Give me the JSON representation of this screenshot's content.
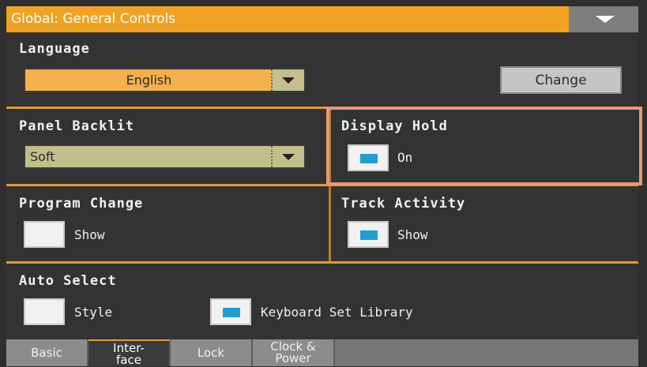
{
  "window": {
    "title": "Global: General Controls"
  },
  "sections": {
    "language": {
      "label": "Language",
      "selected": "English",
      "change_label": "Change"
    },
    "panel_backlit": {
      "label": "Panel Backlit",
      "selected": "Soft"
    },
    "display_hold": {
      "label": "Display Hold",
      "checkbox_label": "On",
      "checked": true
    },
    "program_change": {
      "label": "Program Change",
      "checkbox_label": "Show",
      "checked": false
    },
    "track_activity": {
      "label": "Track Activity",
      "checkbox_label": "Show",
      "checked": true
    },
    "auto_select": {
      "label": "Auto Select",
      "style_label": "Style",
      "style_checked": false,
      "kbd_label": "Keyboard Set Library",
      "kbd_checked": true
    }
  },
  "tabs": [
    {
      "line1": "Basic",
      "line2": ""
    },
    {
      "line1": "Inter-",
      "line2": "face",
      "active": true
    },
    {
      "line1": "Lock",
      "line2": ""
    },
    {
      "line1": "Clock &",
      "line2": "Power"
    }
  ],
  "colors": {
    "accent": "#f0a222",
    "check_fill": "#1d9fd4",
    "highlight": "#e99a73"
  }
}
